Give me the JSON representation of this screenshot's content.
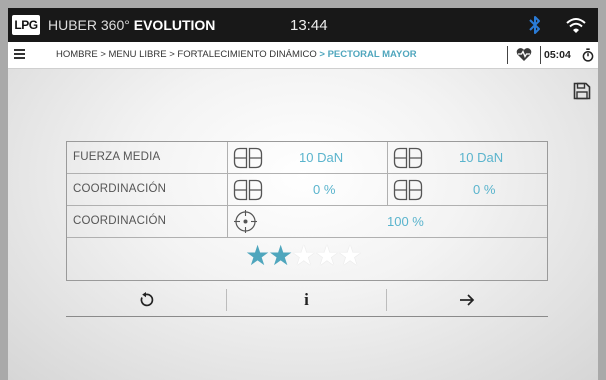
{
  "status_bar": {
    "logo": "LPG",
    "app_name": "HUBER 360°",
    "app_name_bold": "EVOLUTION",
    "time": "13:44"
  },
  "breadcrumb": {
    "path": "HOMBRE > MENU LIBRE  > FORTALECIMIENTO DINÁMICO",
    "separator": " > ",
    "current": "PECTORAL MAYOR",
    "session_time": "05:04"
  },
  "results": {
    "rows": [
      {
        "label": "FUERZA MEDIA",
        "left_value": "10 DaN",
        "right_value": "10 DaN"
      },
      {
        "label": "COORDINACIÓN",
        "left_value": "0 %",
        "right_value": "0 %"
      },
      {
        "label": "COORDINACIÓN",
        "value": "100 %"
      }
    ],
    "rating": {
      "value": 2,
      "max": 5
    }
  },
  "actions": {
    "info_label": "i"
  },
  "colors": {
    "accent": "#5ab4cd",
    "topbar": "#181818"
  },
  "icons": [
    "lpg-logo",
    "bluetooth-icon",
    "wifi-icon",
    "menu-icon",
    "heart-rate-icon",
    "stopwatch-icon",
    "save-icon",
    "feet-icon",
    "target-icon",
    "star-icon",
    "reset-icon",
    "info-icon",
    "arrow-right-icon"
  ]
}
